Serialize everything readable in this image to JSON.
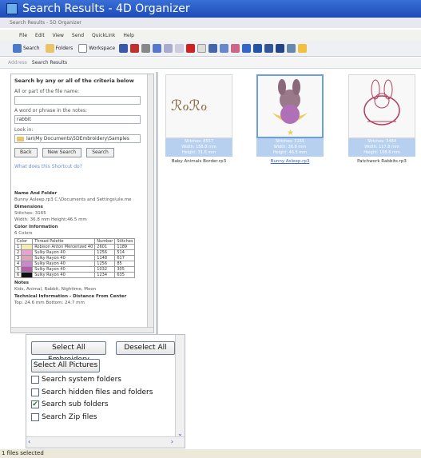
{
  "window": {
    "title": "Search Results - 4D Organizer",
    "subtitle": "Search Results - 5D Organizer"
  },
  "menu": [
    "File",
    "Edit",
    "View",
    "Send",
    "QuickLink",
    "Help"
  ],
  "toolbar": {
    "search": "Search",
    "folders": "Folders",
    "workspace": "Workspace"
  },
  "location": {
    "label": "Address",
    "value": "Search Results"
  },
  "search": {
    "heading": "Search by any or all of the criteria below",
    "filename_label": "All or part of the file name:",
    "filename_value": "",
    "phrase_label": "A word or phrase in the notes:",
    "phrase_value": "rabbit",
    "lookin_label": "Look in:",
    "lookin_value": "Ian\\My Documents\\5DEmbroidery\\Samples",
    "back": "Back",
    "new_search": "New Search",
    "search_btn": "Search",
    "shortcut": "What does this Shortcut do?"
  },
  "info": {
    "name_heading": "Name And Folder",
    "name_row": "Bunny Asleep.rp3    C:\\Documents and Settings\\ule.me",
    "dim_heading": "Dimensions",
    "stitches": "Stitches: 3165",
    "size": "Width: 36.8 mm    Height:46.5 mm",
    "color_heading": "Color Information",
    "colors_count": "6 Colors",
    "table_headers": [
      "Color",
      "Thread Palette",
      "Number",
      "Stitches"
    ],
    "rows": [
      {
        "n": "1",
        "color": "#f2edb0",
        "palette": "Robison Anton Mercerized 40",
        "number": "2601",
        "stitches": "1189"
      },
      {
        "n": "2",
        "color": "#e6a2d2",
        "palette": "Sulky Rayon 40",
        "number": "1256",
        "stitches": "514"
      },
      {
        "n": "3",
        "color": "#d9a8b6",
        "palette": "Sulky Rayon 40",
        "number": "1148",
        "stitches": "617"
      },
      {
        "n": "4",
        "color": "#cc88cc",
        "palette": "Sulky Rayon 40",
        "number": "1256",
        "stitches": "85"
      },
      {
        "n": "5",
        "color": "#b060a8",
        "palette": "Sulky Rayon 40",
        "number": "1032",
        "stitches": "305"
      },
      {
        "n": "6",
        "color": "#111111",
        "palette": "Sulky Rayon 40",
        "number": "1234",
        "stitches": "635"
      }
    ],
    "notes_heading": "Notes",
    "notes": "Kids, Animal, Rabbit, Nightime, Moon",
    "tech_heading": "Technical Information - Distance From Center",
    "tech": "Top: 24.6 mm    Bottom: 24.7 mm"
  },
  "results": [
    {
      "name": "Baby Animals Border.rp3",
      "stitches": "Stitches: 8557",
      "width": "Width: 158.8 mm",
      "height": "Height: 31.6 mm",
      "selected": false
    },
    {
      "name": "Bunny Asleep.rp3",
      "stitches": "Stitches: 3165",
      "width": "Width: 36.8 mm",
      "height": "Height: 46.5 mm",
      "selected": true
    },
    {
      "name": "Patchwork Rabbits.rp3",
      "stitches": "Stitches: 3484",
      "width": "Width: 117.8 mm",
      "height": "Height: 108.6 mm",
      "selected": false
    }
  ],
  "options": {
    "select_all_embroidery": "Select All Embroidery",
    "deselect_all": "Deselect All",
    "select_all_pictures": "Select All Pictures",
    "cb_system": "Search system folders",
    "cb_hidden": "Search hidden files and folders",
    "cb_sub": "Search sub folders",
    "cb_zip": "Search Zip files"
  },
  "status": {
    "text": "1 files selected"
  }
}
